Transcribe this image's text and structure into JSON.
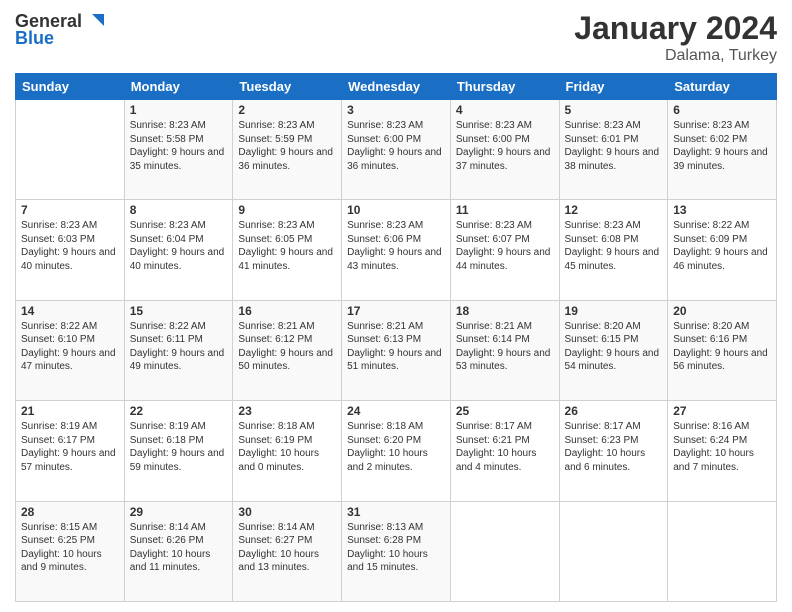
{
  "header": {
    "logo": {
      "general": "General",
      "blue": "Blue"
    },
    "title": "January 2024",
    "location": "Dalama, Turkey"
  },
  "columns": [
    "Sunday",
    "Monday",
    "Tuesday",
    "Wednesday",
    "Thursday",
    "Friday",
    "Saturday"
  ],
  "weeks": [
    [
      {
        "day": "",
        "sunrise": "",
        "sunset": "",
        "daylight": ""
      },
      {
        "day": "1",
        "sunrise": "Sunrise: 8:23 AM",
        "sunset": "Sunset: 5:58 PM",
        "daylight": "Daylight: 9 hours and 35 minutes."
      },
      {
        "day": "2",
        "sunrise": "Sunrise: 8:23 AM",
        "sunset": "Sunset: 5:59 PM",
        "daylight": "Daylight: 9 hours and 36 minutes."
      },
      {
        "day": "3",
        "sunrise": "Sunrise: 8:23 AM",
        "sunset": "Sunset: 6:00 PM",
        "daylight": "Daylight: 9 hours and 36 minutes."
      },
      {
        "day": "4",
        "sunrise": "Sunrise: 8:23 AM",
        "sunset": "Sunset: 6:00 PM",
        "daylight": "Daylight: 9 hours and 37 minutes."
      },
      {
        "day": "5",
        "sunrise": "Sunrise: 8:23 AM",
        "sunset": "Sunset: 6:01 PM",
        "daylight": "Daylight: 9 hours and 38 minutes."
      },
      {
        "day": "6",
        "sunrise": "Sunrise: 8:23 AM",
        "sunset": "Sunset: 6:02 PM",
        "daylight": "Daylight: 9 hours and 39 minutes."
      }
    ],
    [
      {
        "day": "7",
        "sunrise": "Sunrise: 8:23 AM",
        "sunset": "Sunset: 6:03 PM",
        "daylight": "Daylight: 9 hours and 40 minutes."
      },
      {
        "day": "8",
        "sunrise": "Sunrise: 8:23 AM",
        "sunset": "Sunset: 6:04 PM",
        "daylight": "Daylight: 9 hours and 40 minutes."
      },
      {
        "day": "9",
        "sunrise": "Sunrise: 8:23 AM",
        "sunset": "Sunset: 6:05 PM",
        "daylight": "Daylight: 9 hours and 41 minutes."
      },
      {
        "day": "10",
        "sunrise": "Sunrise: 8:23 AM",
        "sunset": "Sunset: 6:06 PM",
        "daylight": "Daylight: 9 hours and 43 minutes."
      },
      {
        "day": "11",
        "sunrise": "Sunrise: 8:23 AM",
        "sunset": "Sunset: 6:07 PM",
        "daylight": "Daylight: 9 hours and 44 minutes."
      },
      {
        "day": "12",
        "sunrise": "Sunrise: 8:23 AM",
        "sunset": "Sunset: 6:08 PM",
        "daylight": "Daylight: 9 hours and 45 minutes."
      },
      {
        "day": "13",
        "sunrise": "Sunrise: 8:22 AM",
        "sunset": "Sunset: 6:09 PM",
        "daylight": "Daylight: 9 hours and 46 minutes."
      }
    ],
    [
      {
        "day": "14",
        "sunrise": "Sunrise: 8:22 AM",
        "sunset": "Sunset: 6:10 PM",
        "daylight": "Daylight: 9 hours and 47 minutes."
      },
      {
        "day": "15",
        "sunrise": "Sunrise: 8:22 AM",
        "sunset": "Sunset: 6:11 PM",
        "daylight": "Daylight: 9 hours and 49 minutes."
      },
      {
        "day": "16",
        "sunrise": "Sunrise: 8:21 AM",
        "sunset": "Sunset: 6:12 PM",
        "daylight": "Daylight: 9 hours and 50 minutes."
      },
      {
        "day": "17",
        "sunrise": "Sunrise: 8:21 AM",
        "sunset": "Sunset: 6:13 PM",
        "daylight": "Daylight: 9 hours and 51 minutes."
      },
      {
        "day": "18",
        "sunrise": "Sunrise: 8:21 AM",
        "sunset": "Sunset: 6:14 PM",
        "daylight": "Daylight: 9 hours and 53 minutes."
      },
      {
        "day": "19",
        "sunrise": "Sunrise: 8:20 AM",
        "sunset": "Sunset: 6:15 PM",
        "daylight": "Daylight: 9 hours and 54 minutes."
      },
      {
        "day": "20",
        "sunrise": "Sunrise: 8:20 AM",
        "sunset": "Sunset: 6:16 PM",
        "daylight": "Daylight: 9 hours and 56 minutes."
      }
    ],
    [
      {
        "day": "21",
        "sunrise": "Sunrise: 8:19 AM",
        "sunset": "Sunset: 6:17 PM",
        "daylight": "Daylight: 9 hours and 57 minutes."
      },
      {
        "day": "22",
        "sunrise": "Sunrise: 8:19 AM",
        "sunset": "Sunset: 6:18 PM",
        "daylight": "Daylight: 9 hours and 59 minutes."
      },
      {
        "day": "23",
        "sunrise": "Sunrise: 8:18 AM",
        "sunset": "Sunset: 6:19 PM",
        "daylight": "Daylight: 10 hours and 0 minutes."
      },
      {
        "day": "24",
        "sunrise": "Sunrise: 8:18 AM",
        "sunset": "Sunset: 6:20 PM",
        "daylight": "Daylight: 10 hours and 2 minutes."
      },
      {
        "day": "25",
        "sunrise": "Sunrise: 8:17 AM",
        "sunset": "Sunset: 6:21 PM",
        "daylight": "Daylight: 10 hours and 4 minutes."
      },
      {
        "day": "26",
        "sunrise": "Sunrise: 8:17 AM",
        "sunset": "Sunset: 6:23 PM",
        "daylight": "Daylight: 10 hours and 6 minutes."
      },
      {
        "day": "27",
        "sunrise": "Sunrise: 8:16 AM",
        "sunset": "Sunset: 6:24 PM",
        "daylight": "Daylight: 10 hours and 7 minutes."
      }
    ],
    [
      {
        "day": "28",
        "sunrise": "Sunrise: 8:15 AM",
        "sunset": "Sunset: 6:25 PM",
        "daylight": "Daylight: 10 hours and 9 minutes."
      },
      {
        "day": "29",
        "sunrise": "Sunrise: 8:14 AM",
        "sunset": "Sunset: 6:26 PM",
        "daylight": "Daylight: 10 hours and 11 minutes."
      },
      {
        "day": "30",
        "sunrise": "Sunrise: 8:14 AM",
        "sunset": "Sunset: 6:27 PM",
        "daylight": "Daylight: 10 hours and 13 minutes."
      },
      {
        "day": "31",
        "sunrise": "Sunrise: 8:13 AM",
        "sunset": "Sunset: 6:28 PM",
        "daylight": "Daylight: 10 hours and 15 minutes."
      },
      {
        "day": "",
        "sunrise": "",
        "sunset": "",
        "daylight": ""
      },
      {
        "day": "",
        "sunrise": "",
        "sunset": "",
        "daylight": ""
      },
      {
        "day": "",
        "sunrise": "",
        "sunset": "",
        "daylight": ""
      }
    ]
  ]
}
